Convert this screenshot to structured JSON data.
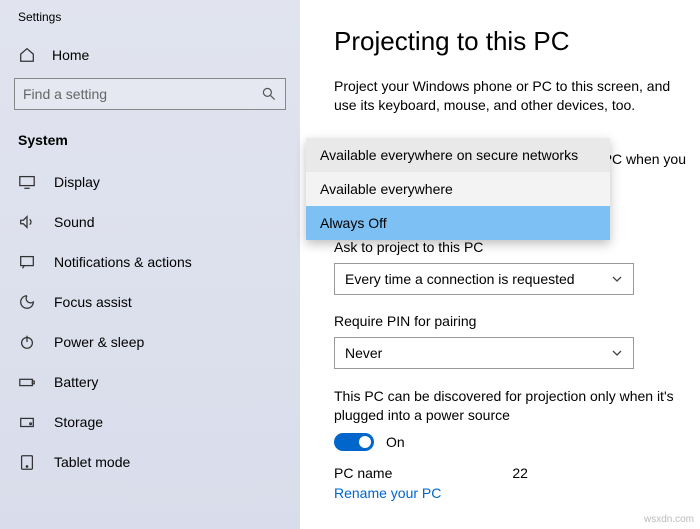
{
  "window": {
    "title": "Settings"
  },
  "sidebar": {
    "home": "Home",
    "search_placeholder": "Find a setting",
    "group": "System",
    "items": [
      {
        "label": "Display"
      },
      {
        "label": "Sound"
      },
      {
        "label": "Notifications & actions"
      },
      {
        "label": "Focus assist"
      },
      {
        "label": "Power & sleep"
      },
      {
        "label": "Battery"
      },
      {
        "label": "Storage"
      },
      {
        "label": "Tablet mode"
      }
    ]
  },
  "main": {
    "title": "Projecting to this PC",
    "desc": "Project your Windows phone or PC to this screen, and use its keyboard, mouse, and other devices, too.",
    "hidden_setting_tail": "PC when you",
    "popup": {
      "options": [
        "Available everywhere on secure networks",
        "Available everywhere",
        "Always Off"
      ]
    },
    "ask": {
      "label": "Ask to project to this PC",
      "value": "Every time a connection is requested"
    },
    "pin": {
      "label": "Require PIN for pairing",
      "value": "Never"
    },
    "discover": {
      "text": "This PC can be discovered for projection only when it's plugged into a power source",
      "toggle_label": "On"
    },
    "pcname": {
      "label": "PC name",
      "value": "22",
      "rename": "Rename your PC"
    }
  },
  "watermark": "wsxdn.com"
}
